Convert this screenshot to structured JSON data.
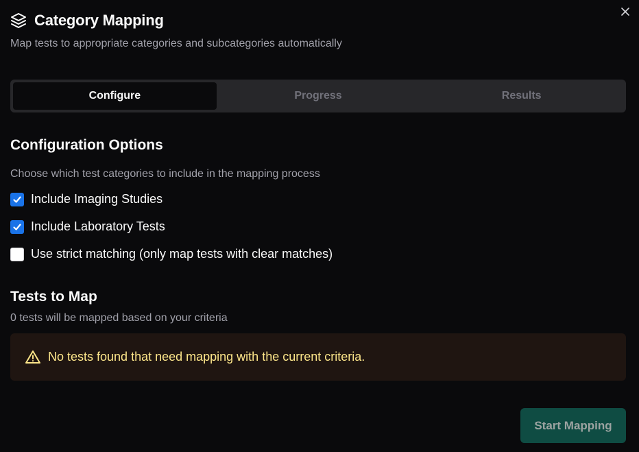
{
  "dialog": {
    "title": "Category Mapping",
    "subtitle": "Map tests to appropriate categories and subcategories automatically",
    "title_icon": "layers-icon",
    "close_icon": "close-icon"
  },
  "tabs": [
    {
      "label": "Configure",
      "active": true
    },
    {
      "label": "Progress",
      "active": false
    },
    {
      "label": "Results",
      "active": false
    }
  ],
  "config": {
    "heading": "Configuration Options",
    "description": "Choose which test categories to include in the mapping process",
    "options": [
      {
        "label": "Include Imaging Studies",
        "checked": true
      },
      {
        "label": "Include Laboratory Tests",
        "checked": true
      },
      {
        "label": "Use strict matching (only map tests with clear matches)",
        "checked": false
      }
    ]
  },
  "tests": {
    "heading": "Tests to Map",
    "count_text": "0 tests will be mapped based on your criteria",
    "alert_icon": "warning-icon",
    "alert_text": "No tests found that need mapping with the current criteria."
  },
  "actions": {
    "start_label": "Start Mapping"
  },
  "colors": {
    "background": "#0a0a0c",
    "tab_track": "#27272a",
    "checkbox_checked": "#1a73e8",
    "alert_bg": "#1f1511",
    "alert_text": "#fde68a",
    "primary_button": "#0f4c43"
  }
}
